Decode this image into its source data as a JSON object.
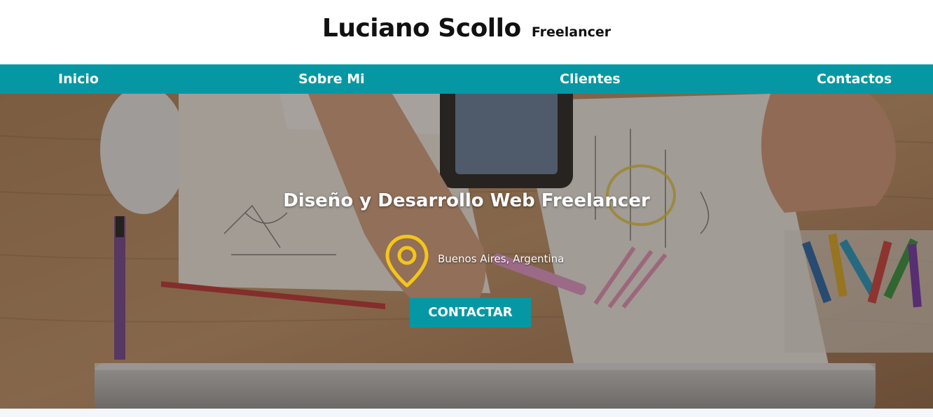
{
  "header": {
    "name": "Luciano Scollo",
    "subtitle": "Freelancer"
  },
  "nav": {
    "items": [
      {
        "label": "Inicio"
      },
      {
        "label": "Sobre Mi"
      },
      {
        "label": "Clientes"
      },
      {
        "label": "Contactos"
      }
    ]
  },
  "hero": {
    "title": "Diseño y Desarrollo Web Freelancer",
    "location": "Buenos Aires, Argentina",
    "location_icon": "map-pin-icon",
    "cta_label": "CONTACTAR",
    "background_description_icon": "desk-photo"
  },
  "colors": {
    "nav": "#0598a4",
    "pin": "#f5c518",
    "text_dark": "#111111"
  }
}
